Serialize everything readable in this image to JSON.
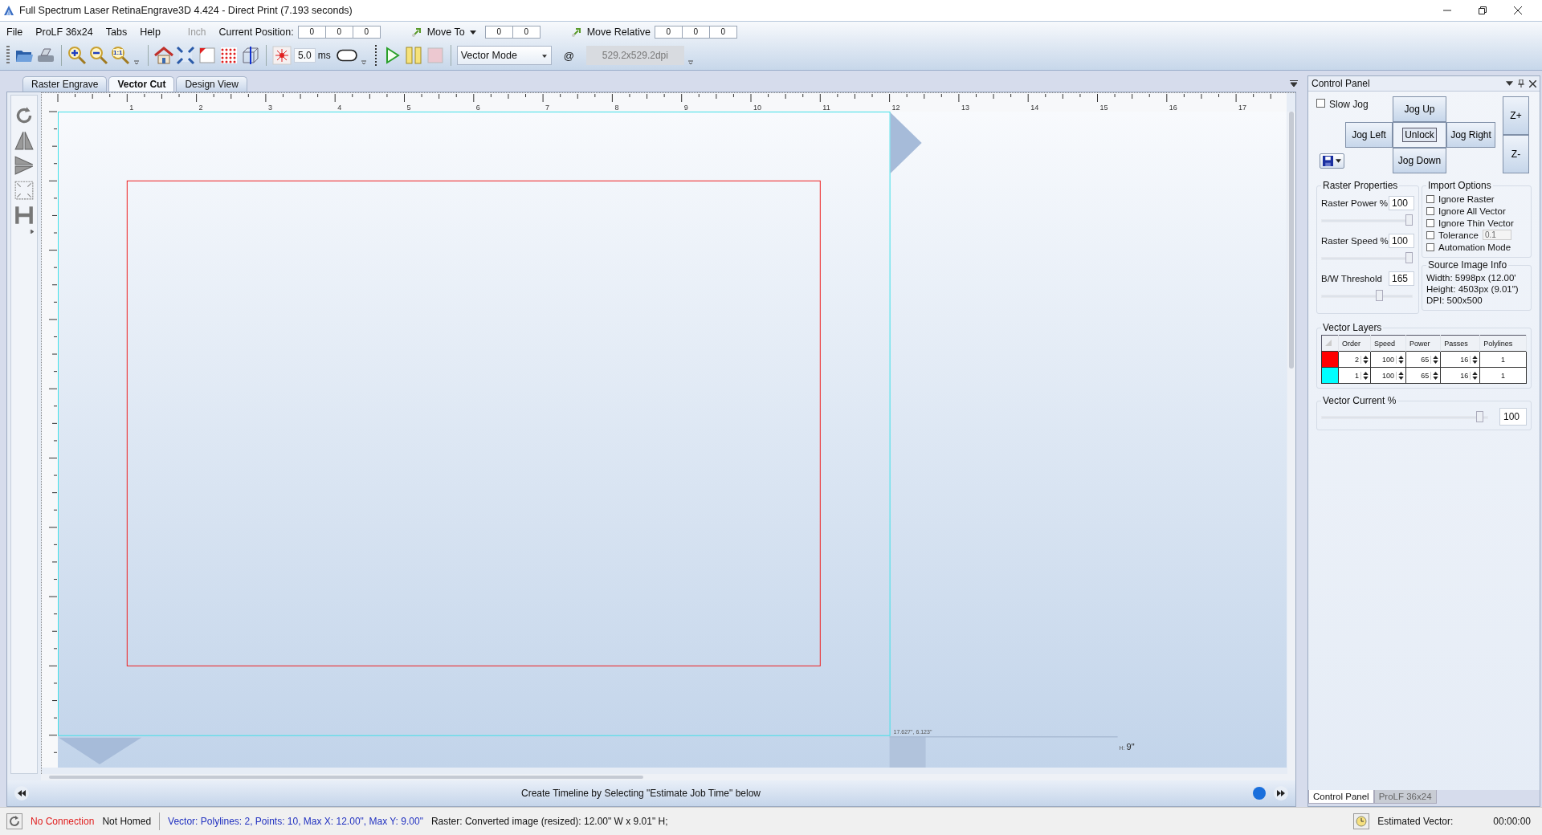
{
  "window": {
    "title": "Full Spectrum Laser RetinaEngrave3D 4.424 - Direct Print (7.193 seconds)"
  },
  "menu": [
    {
      "label": "File"
    },
    {
      "label": "ProLF 36x24"
    },
    {
      "label": "Tabs"
    },
    {
      "label": "Help"
    }
  ],
  "unit": {
    "label": "Inch",
    "disabled": true
  },
  "current_position": {
    "label": "Current Position:",
    "values": [
      "0",
      "0",
      "0"
    ]
  },
  "move_to": {
    "label": "Move To",
    "values": [
      "0",
      "0"
    ]
  },
  "move_relative": {
    "label": "Move Relative",
    "values": [
      "0",
      "0",
      "0"
    ]
  },
  "toolbar": {
    "zoom_actual": "1:1",
    "laser_time": "5.0",
    "laser_time_unit": "ms",
    "mode": "Vector Mode",
    "at": "@",
    "resolution": "529.2x529.2dpi"
  },
  "tabs": [
    {
      "label": "Raster Engrave",
      "selected": false
    },
    {
      "label": "Vector Cut",
      "selected": true
    },
    {
      "label": "Design View",
      "selected": false
    }
  ],
  "ruler": {
    "x_labels": [
      "1",
      "2",
      "3",
      "4",
      "5",
      "6",
      "7",
      "8",
      "9",
      "10",
      "11",
      "12",
      "13",
      "14",
      "15",
      "16",
      "17"
    ]
  },
  "canvas": {
    "cursor_readout": "17.627\", 6.123\"",
    "height_label": "H:",
    "height_value": "9\""
  },
  "timeline": {
    "message": "Create Timeline by Selecting \"Estimate Job Time\" below"
  },
  "control_panel": {
    "title": "Control Panel",
    "slow_jog": {
      "label": "Slow Jog",
      "checked": false
    },
    "jog": {
      "up": "Jog Up",
      "left": "Jog Left",
      "center": "Unlock",
      "right": "Jog Right",
      "down": "Jog Down"
    },
    "z_buttons": [
      "Z+",
      "Z-"
    ],
    "raster_properties": {
      "title": "Raster Properties",
      "fields": [
        {
          "label": "Raster Power %",
          "value": "100",
          "level": 1.0
        },
        {
          "label": "Raster Speed %",
          "value": "100",
          "level": 1.0
        },
        {
          "label": "B/W Threshold",
          "value": "165",
          "level": 0.65
        }
      ]
    },
    "import_options": {
      "title": "Import Options",
      "options": [
        {
          "label": "Ignore Raster",
          "checked": false
        },
        {
          "label": "Ignore All Vector",
          "checked": false
        },
        {
          "label": "Ignore Thin Vector",
          "checked": false
        },
        {
          "label": "Tolerance",
          "checked": false,
          "value": "0.1",
          "disabled": true
        },
        {
          "label": "Automation Mode",
          "checked": false
        }
      ]
    },
    "source_image_info": {
      "title": "Source Image Info",
      "lines": [
        "Width:  5998px (12.00'",
        "Height: 4503px (9.01\")",
        "DPI: 500x500"
      ]
    },
    "vector_layers": {
      "title": "Vector Layers",
      "columns": [
        "Order",
        "Speed",
        "Power",
        "Passes",
        "Polylines"
      ],
      "rows": [
        {
          "color": "#ff0000",
          "order": "2",
          "speed": "100",
          "power": "65",
          "passes": "16",
          "polylines": "1"
        },
        {
          "color": "#00ffff",
          "order": "1",
          "speed": "100",
          "power": "65",
          "passes": "16",
          "polylines": "1"
        }
      ]
    },
    "vector_current": {
      "label": "Vector Current %",
      "value": "100",
      "level": 0.97
    }
  },
  "dock_tabs": [
    {
      "label": "Control Panel",
      "selected": true
    },
    {
      "label": "ProLF 36x24",
      "selected": false
    }
  ],
  "status_bar": {
    "connection": "No Connection",
    "homed": "Not Homed",
    "vector_info": "Vector: Polylines: 2, Points: 10, Max X: 12.00\", Max Y: 9.00\"",
    "raster_info": "Raster: Converted image (resized): 12.00\" W x 9.01\" H;",
    "estimate_label": "Estimated Vector:",
    "estimate_time": "00:00:00"
  }
}
